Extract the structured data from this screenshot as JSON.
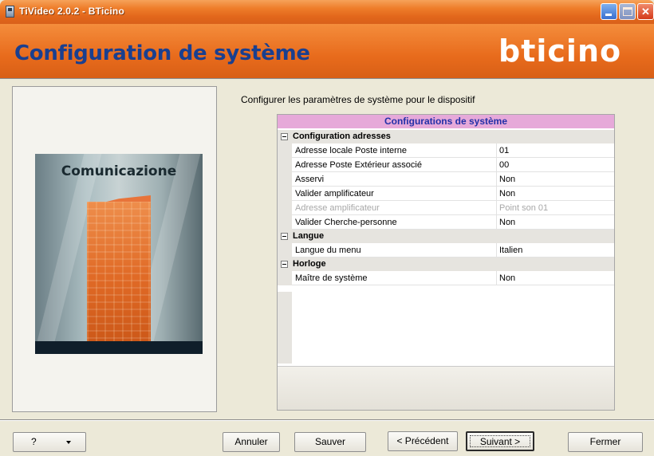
{
  "window": {
    "title": "TiVideo 2.0.2 - BTicino",
    "controls": {
      "minimize": "minimize",
      "maximize": "maximize",
      "close": "close"
    }
  },
  "header": {
    "title": "Configuration de système",
    "logo": "bticino"
  },
  "left_panel": {
    "art_label": "Comunicazione"
  },
  "main": {
    "description": "Configurer les paramètres de système pour le dispositif",
    "grid": {
      "title": "Configurations de système",
      "categories": [
        {
          "label": "Configuration adresses",
          "rows": [
            {
              "name": "Adresse locale Poste interne",
              "value": "01"
            },
            {
              "name": "Adresse Poste Extérieur associé",
              "value": "00"
            },
            {
              "name": "Asservi",
              "value": "Non"
            },
            {
              "name": "Valider amplificateur",
              "value": "Non"
            },
            {
              "name": "Adresse amplificateur",
              "value": "Point son 01",
              "disabled": true
            },
            {
              "name": "Valider Cherche-personne",
              "value": "Non"
            }
          ]
        },
        {
          "label": "Langue",
          "rows": [
            {
              "name": "Langue du menu",
              "value": "Italien"
            }
          ]
        },
        {
          "label": "Horloge",
          "rows": [
            {
              "name": "Maître de système",
              "value": "Non"
            }
          ]
        }
      ]
    }
  },
  "footer": {
    "help_label": "?",
    "cancel_label": "Annuler",
    "save_label": "Sauver",
    "previous_label": "< Précédent",
    "next_label": "Suivant >",
    "close_label": "Fermer"
  },
  "colors": {
    "header_orange": "#e86b1c",
    "title_blue": "#1a3f8f",
    "grid_header_pink": "#e6a9d9",
    "grid_header_text": "#2330a8"
  }
}
